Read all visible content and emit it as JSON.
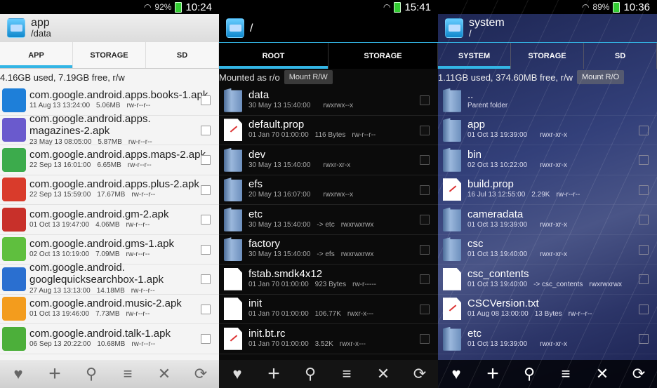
{
  "phones": [
    {
      "status": {
        "signal": "",
        "battery": "92%",
        "time": "10:24"
      },
      "title": "app",
      "subtitle": "/data",
      "tabs": [
        "APP",
        "STORAGE",
        "SD"
      ],
      "info": "4.16GB used, 7.19GB free, r/w",
      "rows": [
        {
          "name": "com.google.android.apps.books-1.apk",
          "date": "11 Aug 13 13:24:00",
          "size": "5.06MB",
          "perm": "rw-r--r--",
          "color": "#1e7fd9"
        },
        {
          "name": "com.google.android.apps.\nmagazines-2.apk",
          "date": "23 May 13 08:05:00",
          "size": "5.87MB",
          "perm": "rw-r--r--",
          "color": "#6a5acd"
        },
        {
          "name": "com.google.android.apps.maps-2.apk",
          "date": "22 Sep 13 16:01:00",
          "size": "6.65MB",
          "perm": "rw-r--r--",
          "color": "#3cab4c"
        },
        {
          "name": "com.google.android.apps.plus-2.apk",
          "date": "22 Sep 13 15:59:00",
          "size": "17.67MB",
          "perm": "rw-r--r--",
          "color": "#d93b2b"
        },
        {
          "name": "com.google.android.gm-2.apk",
          "date": "01 Oct 13 19:47:00",
          "size": "4.06MB",
          "perm": "rw-r--r--",
          "color": "#c8302a"
        },
        {
          "name": "com.google.android.gms-1.apk",
          "date": "02 Oct 13 10:19:00",
          "size": "7.09MB",
          "perm": "rw-r--r--",
          "color": "#5fbf3e"
        },
        {
          "name": "com.google.android.\ngooglequicksearchbox-1.apk",
          "date": "27 Aug 13 13:13:00",
          "size": "14.18MB",
          "perm": "rw-r--r--",
          "color": "#2a6fd0"
        },
        {
          "name": "com.google.android.music-2.apk",
          "date": "01 Oct 13 19:46:00",
          "size": "7.73MB",
          "perm": "rw-r--r--",
          "color": "#f39c1d"
        },
        {
          "name": "com.google.android.talk-1.apk",
          "date": "06 Sep 13 20:22:00",
          "size": "10.68MB",
          "perm": "rw-r--r--",
          "color": "#4caf3a"
        }
      ]
    },
    {
      "status": {
        "time": "15:41"
      },
      "title": "/",
      "subtitle": "",
      "tabs": [
        "ROOT",
        "STORAGE"
      ],
      "info": "Mounted as r/o",
      "mount": "Mount R/W",
      "rows": [
        {
          "name": "data",
          "date": "30 May 13 15:40:00",
          "size": "",
          "perm": "rwxrwx--x",
          "type": "folder"
        },
        {
          "name": "default.prop",
          "date": "01 Jan 70 01:00:00",
          "size": "116 Bytes",
          "perm": "rw-r--r--",
          "type": "filered"
        },
        {
          "name": "dev",
          "date": "30 May 13 15:40:00",
          "size": "",
          "perm": "rwxr-xr-x",
          "type": "folder"
        },
        {
          "name": "efs",
          "date": "20 May 13 16:07:00",
          "size": "",
          "perm": "rwxrwx--x",
          "type": "folder"
        },
        {
          "name": "etc",
          "date": "30 May 13 15:40:00",
          "size": "-> etc",
          "perm": "rwxrwxrwx",
          "type": "folder"
        },
        {
          "name": "factory",
          "date": "30 May 13 15:40:00",
          "size": "-> efs",
          "perm": "rwxrwxrwx",
          "type": "folder"
        },
        {
          "name": "fstab.smdk4x12",
          "date": "01 Jan 70 01:00:00",
          "size": "923 Bytes",
          "perm": "rw-r-----",
          "type": "file"
        },
        {
          "name": "init",
          "date": "01 Jan 70 01:00:00",
          "size": "106.77K",
          "perm": "rwxr-x---",
          "type": "file"
        },
        {
          "name": "init.bt.rc",
          "date": "01 Jan 70 01:00:00",
          "size": "3.52K",
          "perm": "rwxr-x---",
          "type": "filered"
        }
      ]
    },
    {
      "status": {
        "battery": "89%",
        "time": "10:36"
      },
      "title": "system",
      "subtitle": "/",
      "tabs": [
        "SYSTEM",
        "STORAGE",
        "SD"
      ],
      "info": "1.11GB used, 374.60MB free, r/w",
      "mount": "Mount R/O",
      "rows": [
        {
          "name": "..",
          "date": "Parent folder",
          "size": "",
          "perm": "",
          "type": "folder"
        },
        {
          "name": "app",
          "date": "01 Oct 13 19:39:00",
          "size": "",
          "perm": "rwxr-xr-x",
          "type": "folder"
        },
        {
          "name": "bin",
          "date": "02 Oct 13 10:22:00",
          "size": "",
          "perm": "rwxr-xr-x",
          "type": "folder"
        },
        {
          "name": "build.prop",
          "date": "16 Jul 13 12:55:00",
          "size": "2.29K",
          "perm": "rw-r--r--",
          "type": "filered"
        },
        {
          "name": "cameradata",
          "date": "01 Oct 13 19:39:00",
          "size": "",
          "perm": "rwxr-xr-x",
          "type": "folder"
        },
        {
          "name": "csc",
          "date": "01 Oct 13 19:40:00",
          "size": "",
          "perm": "rwxr-xr-x",
          "type": "folder"
        },
        {
          "name": "csc_contents",
          "date": "01 Oct 13 19:40:00",
          "size": "-> csc_contents",
          "perm": "rwxrwxrwx",
          "type": "file"
        },
        {
          "name": "CSCVersion.txt",
          "date": "01 Aug 08 13:00:00",
          "size": "13 Bytes",
          "perm": "rw-r--r--",
          "type": "filered"
        },
        {
          "name": "etc",
          "date": "01 Oct 13 19:39:00",
          "size": "",
          "perm": "rwxr-xr-x",
          "type": "folder"
        }
      ]
    }
  ],
  "bottom_icons": [
    "heart-icon",
    "plus-icon",
    "search-icon",
    "sort-icon",
    "close-icon",
    "refresh-icon"
  ],
  "accent": "#33b5e5"
}
